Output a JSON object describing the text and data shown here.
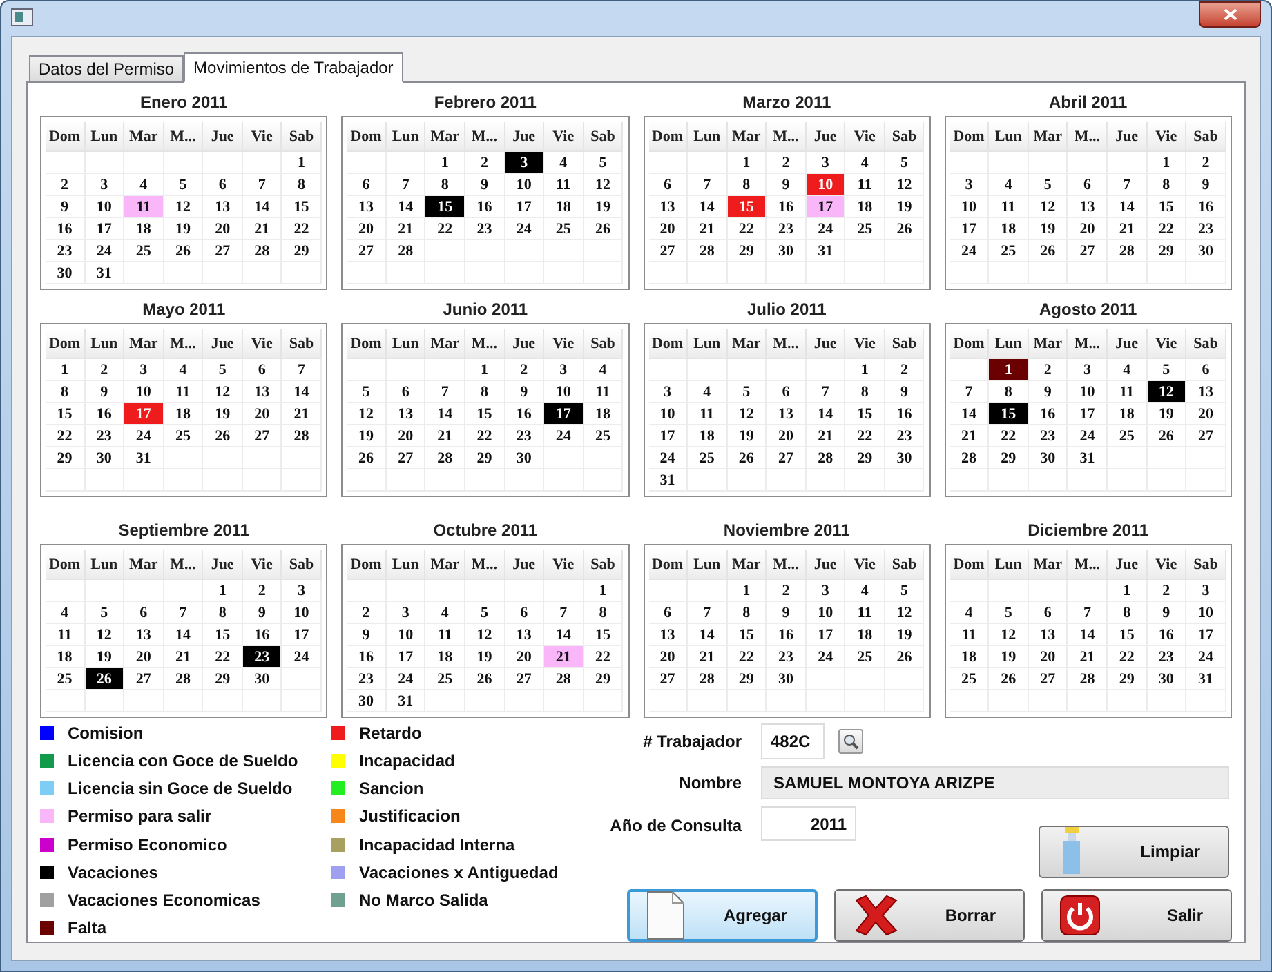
{
  "tabs": [
    {
      "label": "Datos del Permiso",
      "selected": false
    },
    {
      "label": "Movimientos de Trabajador",
      "selected": true
    }
  ],
  "months": [
    {
      "title": "Enero 2011",
      "weekdays": [
        "Dom",
        "Lun",
        "Mar",
        "M...",
        "Jue",
        "Vie",
        "Sab"
      ],
      "cells": [
        null,
        null,
        null,
        null,
        null,
        null,
        "1",
        "2",
        "3",
        "4",
        "5",
        "6",
        "7",
        "8",
        "9",
        "10",
        {
          "day": "11",
          "color": "#f9b6f9"
        },
        "12",
        "13",
        "14",
        "15",
        "16",
        "17",
        "18",
        "19",
        "20",
        "21",
        "22",
        "23",
        "24",
        "25",
        "26",
        "27",
        "28",
        "29",
        "30",
        "31"
      ]
    },
    {
      "title": "Febrero 2011",
      "weekdays": [
        "Dom",
        "Lun",
        "Mar",
        "M...",
        "Jue",
        "Vie",
        "Sab"
      ],
      "cells": [
        null,
        null,
        "1",
        "2",
        {
          "day": "3",
          "color": "#000000"
        },
        "4",
        "5",
        "6",
        "7",
        "8",
        "9",
        "10",
        "11",
        "12",
        "13",
        "14",
        {
          "day": "15",
          "color": "#000000"
        },
        "16",
        "17",
        "18",
        "19",
        "20",
        "21",
        "22",
        "23",
        "24",
        "25",
        "26",
        "27",
        "28"
      ]
    },
    {
      "title": "Marzo 2011",
      "weekdays": [
        "Dom",
        "Lun",
        "Mar",
        "M...",
        "Jue",
        "Vie",
        "Sab"
      ],
      "cells": [
        null,
        null,
        "1",
        "2",
        "3",
        "4",
        "5",
        "6",
        "7",
        "8",
        "9",
        {
          "day": "10",
          "color": "#ee1c1c"
        },
        "11",
        "12",
        "13",
        "14",
        {
          "day": "15",
          "color": "#ee1c1c"
        },
        "16",
        {
          "day": "17",
          "color": "#f9b6f9"
        },
        "18",
        "19",
        "20",
        "21",
        "22",
        "23",
        "24",
        "25",
        "26",
        "27",
        "28",
        "29",
        "30",
        "31"
      ]
    },
    {
      "title": "Abril 2011",
      "weekdays": [
        "Dom",
        "Lun",
        "Mar",
        "M...",
        "Jue",
        "Vie",
        "Sab"
      ],
      "cells": [
        null,
        null,
        null,
        null,
        null,
        "1",
        "2",
        "3",
        "4",
        "5",
        "6",
        "7",
        "8",
        "9",
        "10",
        "11",
        "12",
        "13",
        "14",
        "15",
        "16",
        "17",
        "18",
        "19",
        "20",
        "21",
        "22",
        "23",
        "24",
        "25",
        "26",
        "27",
        "28",
        "29",
        "30"
      ]
    },
    {
      "title": "Mayo 2011",
      "weekdays": [
        "Dom",
        "Lun",
        "Mar",
        "M...",
        "Jue",
        "Vie",
        "Sab"
      ],
      "cells": [
        "1",
        "2",
        "3",
        "4",
        "5",
        "6",
        "7",
        "8",
        "9",
        "10",
        "11",
        "12",
        "13",
        "14",
        "15",
        "16",
        {
          "day": "17",
          "color": "#ee1c1c"
        },
        "18",
        "19",
        "20",
        "21",
        "22",
        "23",
        "24",
        "25",
        "26",
        "27",
        "28",
        "29",
        "30",
        "31"
      ]
    },
    {
      "title": "Junio 2011",
      "weekdays": [
        "Dom",
        "Lun",
        "Mar",
        "M...",
        "Jue",
        "Vie",
        "Sab"
      ],
      "cells": [
        null,
        null,
        null,
        "1",
        "2",
        "3",
        "4",
        "5",
        "6",
        "7",
        "8",
        "9",
        "10",
        "11",
        "12",
        "13",
        "14",
        "15",
        "16",
        {
          "day": "17",
          "color": "#000000"
        },
        "18",
        "19",
        "20",
        "21",
        "22",
        "23",
        "24",
        "25",
        "26",
        "27",
        "28",
        "29",
        "30"
      ]
    },
    {
      "title": "Julio 2011",
      "weekdays": [
        "Dom",
        "Lun",
        "Mar",
        "M...",
        "Jue",
        "Vie",
        "Sab"
      ],
      "cells": [
        null,
        null,
        null,
        null,
        null,
        "1",
        "2",
        "3",
        "4",
        "5",
        "6",
        "7",
        "8",
        "9",
        "10",
        "11",
        "12",
        "13",
        "14",
        "15",
        "16",
        "17",
        "18",
        "19",
        "20",
        "21",
        "22",
        "23",
        "24",
        "25",
        "26",
        "27",
        "28",
        "29",
        "30",
        "31"
      ]
    },
    {
      "title": "Agosto 2011",
      "weekdays": [
        "Dom",
        "Lun",
        "Mar",
        "M...",
        "Jue",
        "Vie",
        "Sab"
      ],
      "cells": [
        null,
        {
          "day": "1",
          "color": "#6b0000"
        },
        "2",
        "3",
        "4",
        "5",
        "6",
        "7",
        "8",
        "9",
        "10",
        "11",
        {
          "day": "12",
          "color": "#000000"
        },
        "13",
        "14",
        {
          "day": "15",
          "color": "#000000"
        },
        "16",
        "17",
        "18",
        "19",
        "20",
        "21",
        "22",
        "23",
        "24",
        "25",
        "26",
        "27",
        "28",
        "29",
        "30",
        "31"
      ]
    },
    {
      "title": "Septiembre 2011",
      "weekdays": [
        "Dom",
        "Lun",
        "Mar",
        "M...",
        "Jue",
        "Vie",
        "Sab"
      ],
      "cells": [
        null,
        null,
        null,
        null,
        "1",
        "2",
        "3",
        "4",
        "5",
        "6",
        "7",
        "8",
        "9",
        "10",
        "11",
        "12",
        "13",
        "14",
        "15",
        "16",
        "17",
        "18",
        "19",
        "20",
        "21",
        "22",
        {
          "day": "23",
          "color": "#000000"
        },
        "24",
        "25",
        {
          "day": "26",
          "color": "#000000"
        },
        "27",
        "28",
        "29",
        "30"
      ]
    },
    {
      "title": "Octubre 2011",
      "weekdays": [
        "Dom",
        "Lun",
        "Mar",
        "M...",
        "Jue",
        "Vie",
        "Sab"
      ],
      "cells": [
        null,
        null,
        null,
        null,
        null,
        null,
        "1",
        "2",
        "3",
        "4",
        "5",
        "6",
        "7",
        "8",
        "9",
        "10",
        "11",
        "12",
        "13",
        "14",
        "15",
        "16",
        "17",
        "18",
        "19",
        "20",
        {
          "day": "21",
          "color": "#f9b6f9"
        },
        "22",
        "23",
        "24",
        "25",
        "26",
        "27",
        "28",
        "29",
        "30",
        "31"
      ]
    },
    {
      "title": "Noviembre 2011",
      "weekdays": [
        "Dom",
        "Lun",
        "Mar",
        "M...",
        "Jue",
        "Vie",
        "Sab"
      ],
      "cells": [
        null,
        null,
        "1",
        "2",
        "3",
        "4",
        "5",
        "6",
        "7",
        "8",
        "9",
        "10",
        "11",
        "12",
        "13",
        "14",
        "15",
        "16",
        "17",
        "18",
        "19",
        "20",
        "21",
        "22",
        "23",
        "24",
        "25",
        "26",
        "27",
        "28",
        "29",
        "30"
      ]
    },
    {
      "title": "Diciembre 2011",
      "weekdays": [
        "Dom",
        "Lun",
        "Mar",
        "M...",
        "Jue",
        "Vie",
        "Sab"
      ],
      "cells": [
        null,
        null,
        null,
        null,
        "1",
        "2",
        "3",
        "4",
        "5",
        "6",
        "7",
        "8",
        "9",
        "10",
        "11",
        "12",
        "13",
        "14",
        "15",
        "16",
        "17",
        "18",
        "19",
        "20",
        "21",
        "22",
        "23",
        "24",
        "25",
        "26",
        "27",
        "28",
        "29",
        "30",
        "31"
      ]
    }
  ],
  "legend": [
    {
      "label": "Comision",
      "color": "#0000ff"
    },
    {
      "label": "Licencia con Goce de Sueldo",
      "color": "#119a4a"
    },
    {
      "label": "Licencia sin Goce de Sueldo",
      "color": "#7dcdf5"
    },
    {
      "label": "Permiso para salir",
      "color": "#f9b6f9"
    },
    {
      "label": "Permiso Economico",
      "color": "#cc00cc"
    },
    {
      "label": "Vacaciones",
      "color": "#000000"
    },
    {
      "label": "Vacaciones Economicas",
      "color": "#a0a0a0"
    },
    {
      "label": "Falta",
      "color": "#6b0000"
    },
    {
      "label": "Retardo",
      "color": "#ee1c1c"
    },
    {
      "label": "Incapacidad",
      "color": "#ffff00"
    },
    {
      "label": "Sancion",
      "color": "#22ee22"
    },
    {
      "label": "Justificacion",
      "color": "#f7861b"
    },
    {
      "label": "Incapacidad Interna",
      "color": "#a8a060"
    },
    {
      "label": "Vacaciones x Antiguedad",
      "color": "#a0a0f0"
    },
    {
      "label": "No Marco Salida",
      "color": "#70a090"
    }
  ],
  "form": {
    "worker_label": "# Trabajador",
    "worker_value": "482C",
    "name_label": "Nombre",
    "name_value": "SAMUEL MONTOYA ARIZPE",
    "year_label": "Año de Consulta",
    "year_value": "2011"
  },
  "buttons": [
    {
      "kind": "clear",
      "label": "Limpiar",
      "focused": false
    },
    {
      "kind": "add",
      "label": "Agregar",
      "focused": true
    },
    {
      "kind": "delete",
      "label": "Borrar",
      "focused": false
    },
    {
      "kind": "exit",
      "label": "Salir",
      "focused": false
    }
  ]
}
